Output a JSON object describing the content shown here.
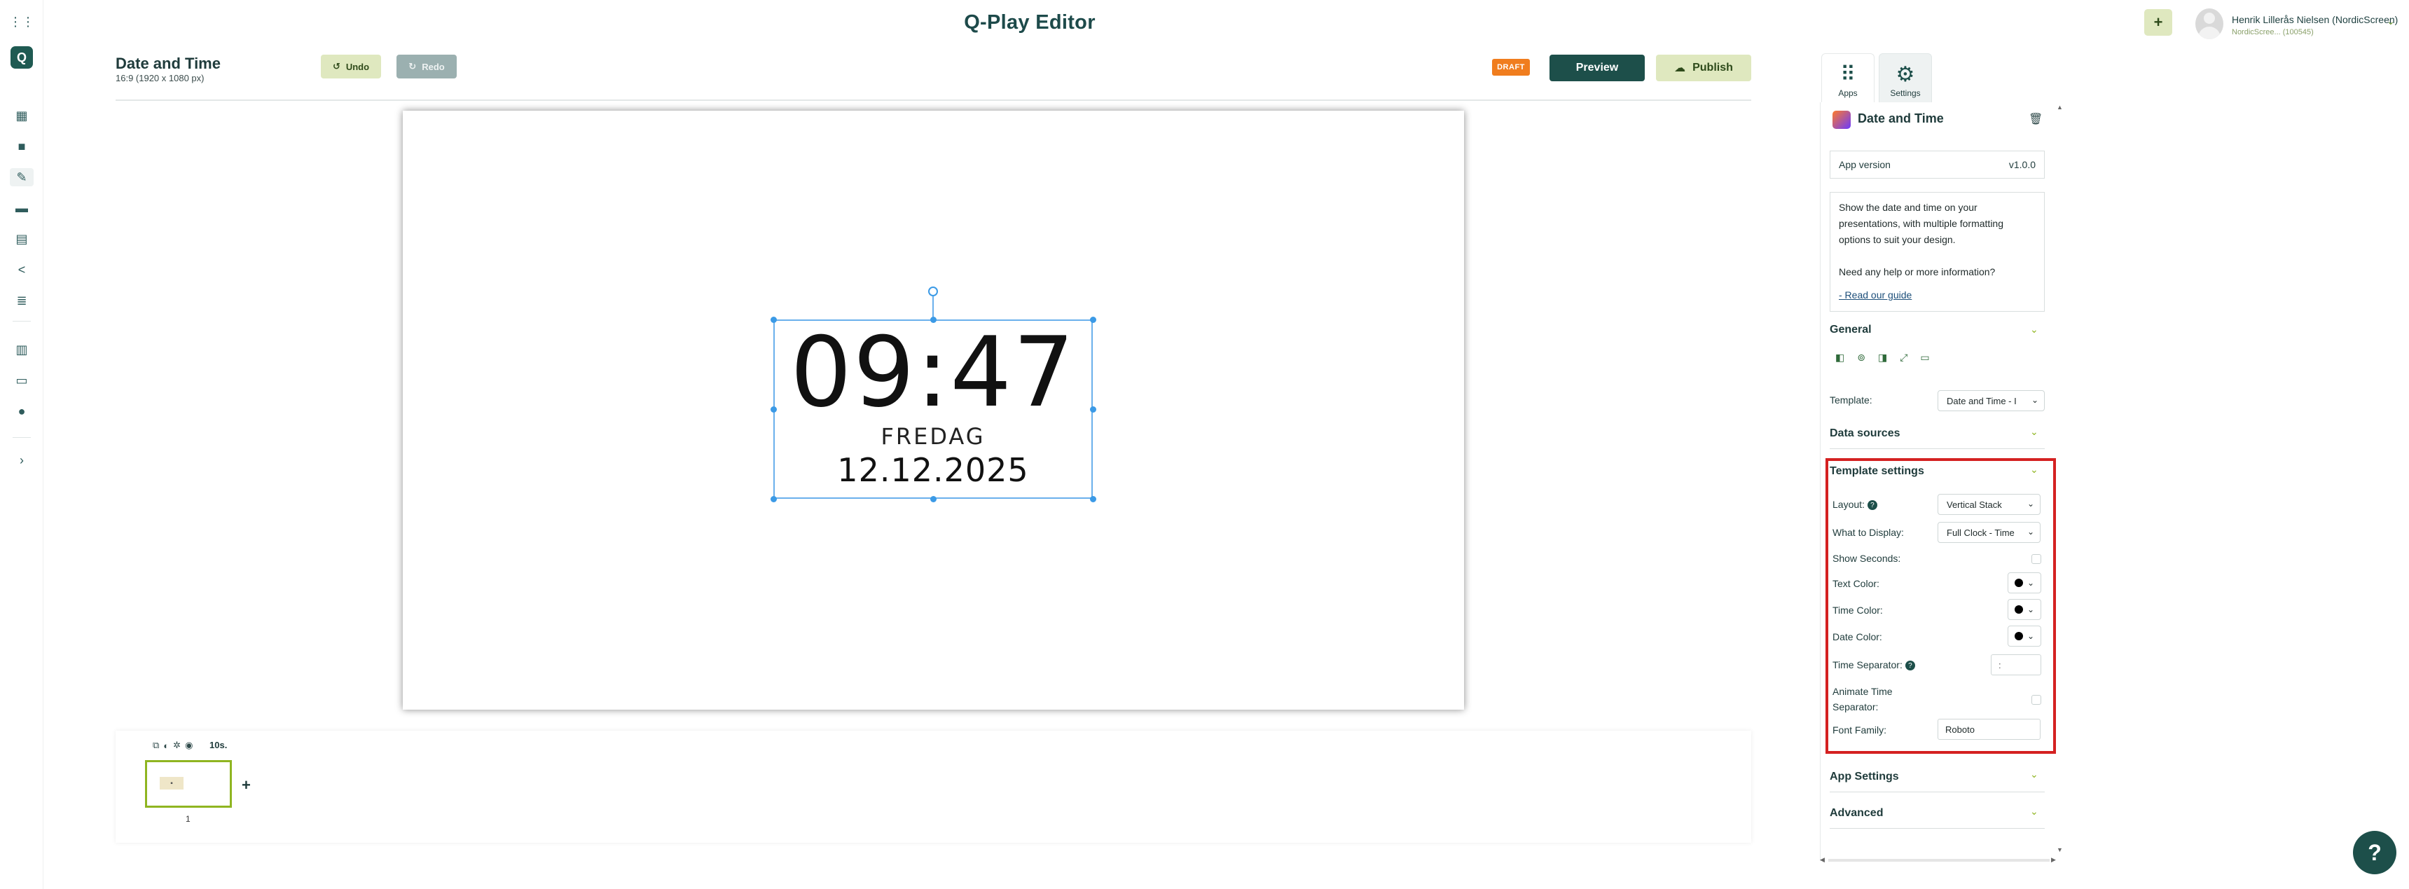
{
  "header": {
    "app_title": "Q-Play Editor",
    "user_name": "Henrik Lillerås Nielsen (NordicScreen)",
    "user_sub": "NordicScree... (100545)"
  },
  "rail": {
    "icons": [
      "grid-icon",
      "logo",
      "dashboard-icon",
      "media-icon",
      "editor-icon",
      "screens-icon",
      "playlists-icon",
      "share-icon",
      "reports-icon",
      "list-icon",
      "display-icon",
      "info-icon",
      "expand-icon"
    ]
  },
  "editor": {
    "title": "Date and Time",
    "subtitle": "16:9 (1920 x 1080 px)",
    "undo_label": "Undo",
    "redo_label": "Redo",
    "draft_badge": "DRAFT",
    "preview_label": "Preview",
    "publish_label": "Publish"
  },
  "clock": {
    "time": "09:47",
    "day": "FREDAG",
    "date": "12.12.2025"
  },
  "timeline": {
    "duration": "10s.",
    "slide_number": "1",
    "add_label": "+"
  },
  "panel": {
    "tabs": [
      {
        "label": "Apps",
        "icon": "apps-grid-icon"
      },
      {
        "label": "Settings",
        "icon": "gear-icon"
      }
    ],
    "app_title": "Date and Time",
    "version_label": "App version",
    "version_value": "v1.0.0",
    "description": "Show the date and time on your presentations, with multiple formatting options to suit your design.",
    "help_text": "Need any help or more information?",
    "guide_link": "- Read our guide",
    "sections": {
      "general": "General",
      "data_sources": "Data sources",
      "template_settings": "Template settings",
      "app_settings": "App Settings",
      "advanced": "Advanced"
    },
    "template_label": "Template:",
    "template_value": "Date and Time - I",
    "template_settings": {
      "layout_label": "Layout:",
      "layout_value": "Vertical Stack",
      "display_label": "What to Display:",
      "display_value": "Full Clock - Time",
      "show_seconds_label": "Show Seconds:",
      "text_color_label": "Text Color:",
      "time_color_label": "Time Color:",
      "date_color_label": "Date Color:",
      "separator_label": "Time Separator:",
      "separator_value": ":",
      "animate_label": "Animate Time Separator:",
      "font_label": "Font Family:",
      "font_value": "Roboto"
    },
    "colors": {
      "text": "#000000",
      "time": "#000000",
      "date": "#000000",
      "highlight_frame": "#d42121"
    }
  },
  "help_fab": "?"
}
